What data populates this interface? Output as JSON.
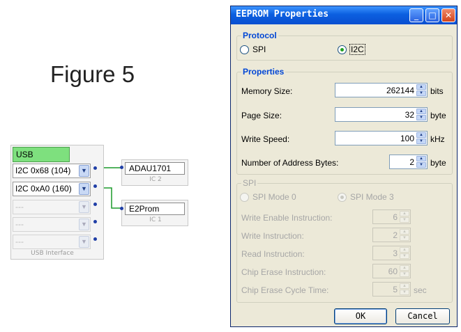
{
  "figure": {
    "title": "Figure 5"
  },
  "usb": {
    "header": "USB",
    "rows": [
      "I2C 0x68 (104)",
      "I2C 0xA0 (160)",
      "---",
      "---",
      "---"
    ],
    "footer": "USB Interface"
  },
  "ics": [
    {
      "name": "ADAU1701",
      "sub": "IC 2"
    },
    {
      "name": "E2Prom",
      "sub": "IC 1"
    }
  ],
  "dialog": {
    "title": "EEPROM Properties",
    "protocol": {
      "label": "Protocol",
      "spi": "SPI",
      "i2c": "I2C",
      "selected": "I2C"
    },
    "properties": {
      "label": "Properties",
      "memory_size": {
        "label": "Memory Size:",
        "value": "262144",
        "unit": "bits"
      },
      "page_size": {
        "label": "Page Size:",
        "value": "32",
        "unit": "byte"
      },
      "write_speed": {
        "label": "Write Speed:",
        "value": "100",
        "unit": "kHz"
      },
      "address_bytes": {
        "label": "Number of Address Bytes:",
        "value": "2",
        "unit": "byte"
      }
    },
    "spi": {
      "label": "SPI",
      "mode0": "SPI Mode 0",
      "mode3": "SPI Mode 3",
      "selected": "SPI Mode 3",
      "write_enable": {
        "label": "Write Enable Instruction:",
        "value": "6"
      },
      "write_instruction": {
        "label": "Write Instruction:",
        "value": "2"
      },
      "read_instruction": {
        "label": "Read Instruction:",
        "value": "3"
      },
      "chip_erase": {
        "label": "Chip Erase Instruction:",
        "value": "60"
      },
      "chip_erase_cycle": {
        "label": "Chip Erase Cycle Time:",
        "value": "5",
        "unit": "sec"
      }
    },
    "buttons": {
      "ok": "OK",
      "cancel": "Cancel"
    }
  },
  "colors": {
    "usb_header": "#7ee07e",
    "titlebar": "#0b5fe0",
    "close_button": "#d2441c",
    "wire": "#1a9a2a"
  }
}
